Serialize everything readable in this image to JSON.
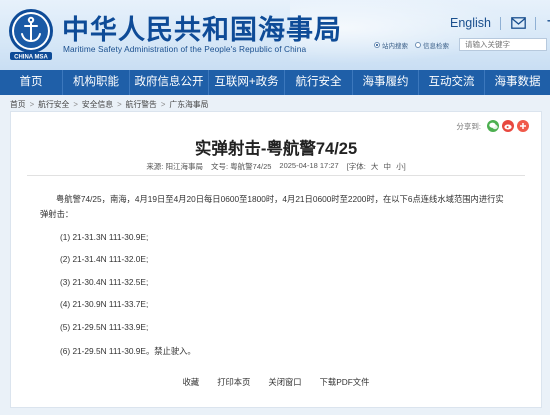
{
  "header": {
    "title": "中华人民共和国海事局",
    "subtitle": "Maritime Safety Administration of the People's Republic of China",
    "logo_text": "CHINA MSA",
    "lang_link": "English",
    "search_options": [
      "站内搜索",
      "信息检索"
    ],
    "search_selected": "站内搜索",
    "search_placeholder": "请输入关键字"
  },
  "nav": {
    "items": [
      "首页",
      "机构职能",
      "政府信息公开",
      "互联网+政务",
      "航行安全",
      "海事履约",
      "互动交流",
      "海事数据"
    ]
  },
  "breadcrumb": [
    "首页",
    "航行安全",
    "安全信息",
    "航行警告",
    "广东海事局"
  ],
  "article": {
    "share_label": "分享到:",
    "title": "实弹射击-粤航警74/25",
    "source": "来源:  阳江海事局",
    "doc_no": "文号:  粤航警74/25",
    "date": "2025-04-18 17:27",
    "font_label": "[字体:",
    "font_sizes": [
      "大",
      "中",
      "小"
    ],
    "font_end": "]",
    "paragraph": "粤航警74/25，南海，4月19日至4月20日每日0600至1800时，4月21日0600时至2200时，在以下6点连线水域范围内进行实弹射击：",
    "points": [
      "(1) 21-31.3N 111-30.9E;",
      "(2) 21-31.4N 111-32.0E;",
      "(3) 21-30.4N 111-32.5E;",
      "(4) 21-30.9N 111-33.7E;",
      "(5) 21-29.5N 111-33.9E;",
      "(6) 21-29.5N 111-30.9E。禁止驶入。"
    ],
    "actions": [
      "收藏",
      "打印本页",
      "关闭窗口",
      "下载PDF文件"
    ]
  },
  "colors": {
    "nav_bg": "#1f5fa8",
    "title_blue": "#0e4b97",
    "wechat": "#4caf50",
    "weibo": "#e8483f",
    "other": "#f05a4a"
  },
  "icons": {
    "mail": "mail-icon",
    "accessibility": "accessibility-icon",
    "wechat": "wechat-icon",
    "weibo": "weibo-icon",
    "more": "share-more-icon"
  }
}
